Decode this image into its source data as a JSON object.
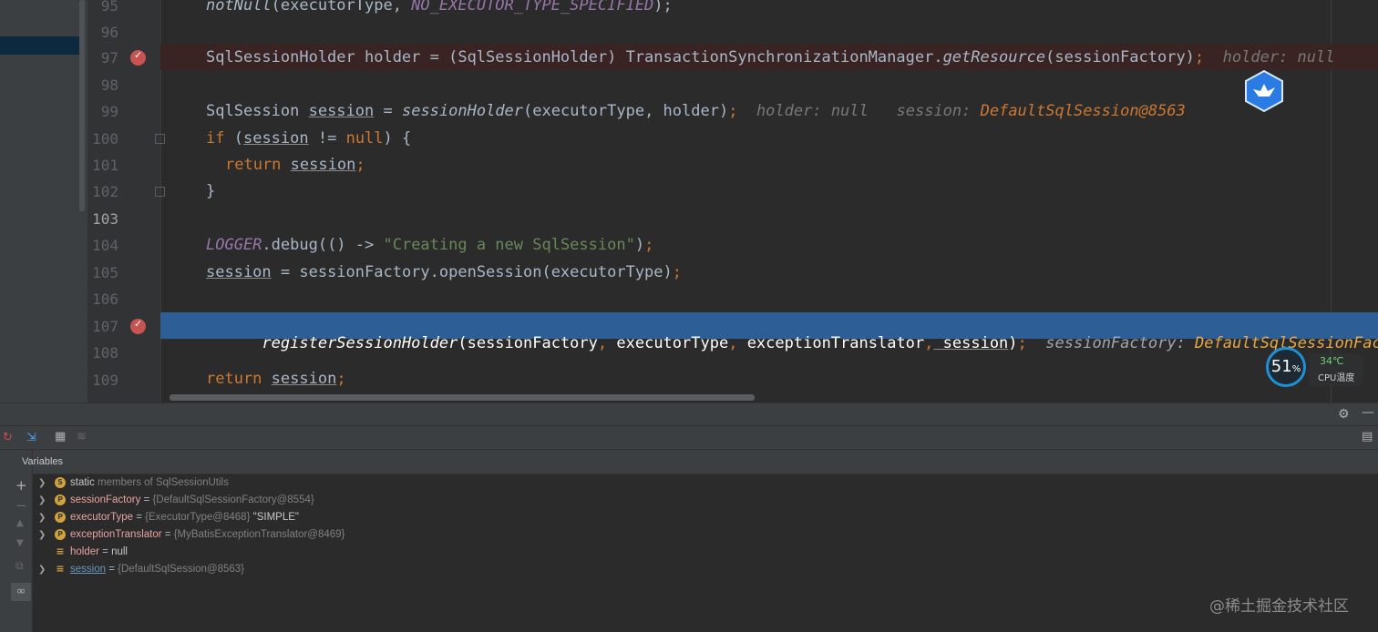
{
  "editor": {
    "lines": [
      {
        "num": "95"
      },
      {
        "num": "96"
      },
      {
        "num": "97"
      },
      {
        "num": "98"
      },
      {
        "num": "99"
      },
      {
        "num": "100"
      },
      {
        "num": "101"
      },
      {
        "num": "102"
      },
      {
        "num": "103"
      },
      {
        "num": "104"
      },
      {
        "num": "105"
      },
      {
        "num": "106"
      },
      {
        "num": "107"
      },
      {
        "num": "108"
      },
      {
        "num": "109"
      }
    ],
    "code": {
      "l95_fn": "notNull",
      "l95_args": "(executorType, ",
      "l95_const": "NO_EXECUTOR_TYPE_SPECIFIED",
      "l95_end": ");",
      "l97_a": "SqlSessionHolder holder = (SqlSessionHolder) TransactionSynchronizationManager.",
      "l97_fn": "getResource",
      "l97_b": "(sessionFactory)",
      "l97_semi": ";",
      "l97_hint": "holder: null",
      "l99_a": "SqlSession ",
      "l99_var": "session",
      "l99_b": " = ",
      "l99_fn": "sessionHolder",
      "l99_c": "(executorType, holder)",
      "l99_semi": ";",
      "l99_hint1": "holder: null",
      "l99_hint2_label": "session: ",
      "l99_hint2_val": "DefaultSqlSession@8563",
      "l100_kw": "if",
      "l100_a": " (",
      "l100_var": "session",
      "l100_b": " != ",
      "l100_null": "null",
      "l100_c": ") {",
      "l101_kw": "return",
      "l101_var": "session",
      "l101_semi": ";",
      "l102": "}",
      "l104_logger": "LOGGER",
      "l104_a": ".debug(() -> ",
      "l104_str": "\"Creating a new SqlSession\"",
      "l104_b": ")",
      "l104_semi": ";",
      "l105_var": "session",
      "l105_a": " = sessionFactory.openSession(executorType)",
      "l105_semi": ";",
      "l107_fn": "registerSessionHolder",
      "l107_a": "(sessionFactory",
      "l107_c1": ",",
      "l107_b": " executorType",
      "l107_c2": ",",
      "l107_c": " exceptionTranslator",
      "l107_c3": ",",
      "l107_var": " session",
      "l107_d": ")",
      "l107_semi": ";",
      "l107_hint_label": "sessionFactory: ",
      "l107_hint_val": "DefaultSqlSessionFact",
      "l109_kw": "return",
      "l109_var": "session",
      "l109_semi": ";"
    }
  },
  "cpu_widget": {
    "percent": "51",
    "percent_unit": "%",
    "temperature": "34℃",
    "label": "CPU温度"
  },
  "debug": {
    "variables_title": "Variables",
    "variables": [
      {
        "name": "static",
        "rest": " members of SqlSessionUtils",
        "value": "",
        "icon": "S",
        "expandable": true,
        "name_style": "static"
      },
      {
        "name": "sessionFactory",
        "sep": " = ",
        "value": "{DefaultSqlSessionFactory@8554}",
        "icon": "P",
        "expandable": true
      },
      {
        "name": "executorType",
        "sep": " = ",
        "value": "{ExecutorType@8468}",
        "extra": " \"SIMPLE\"",
        "icon": "P",
        "expandable": true
      },
      {
        "name": "exceptionTranslator",
        "sep": " = ",
        "value": "{MyBatisExceptionTranslator@8469}",
        "icon": "P",
        "expandable": true
      },
      {
        "name": "holder",
        "sep": " = ",
        "value": "null",
        "icon": "≡",
        "expandable": false
      },
      {
        "name": "session",
        "sep": " = ",
        "value": "{DefaultSqlSession@8563}",
        "icon": "≡",
        "expandable": true
      }
    ]
  },
  "watermark": "@稀土掘金技术社区"
}
